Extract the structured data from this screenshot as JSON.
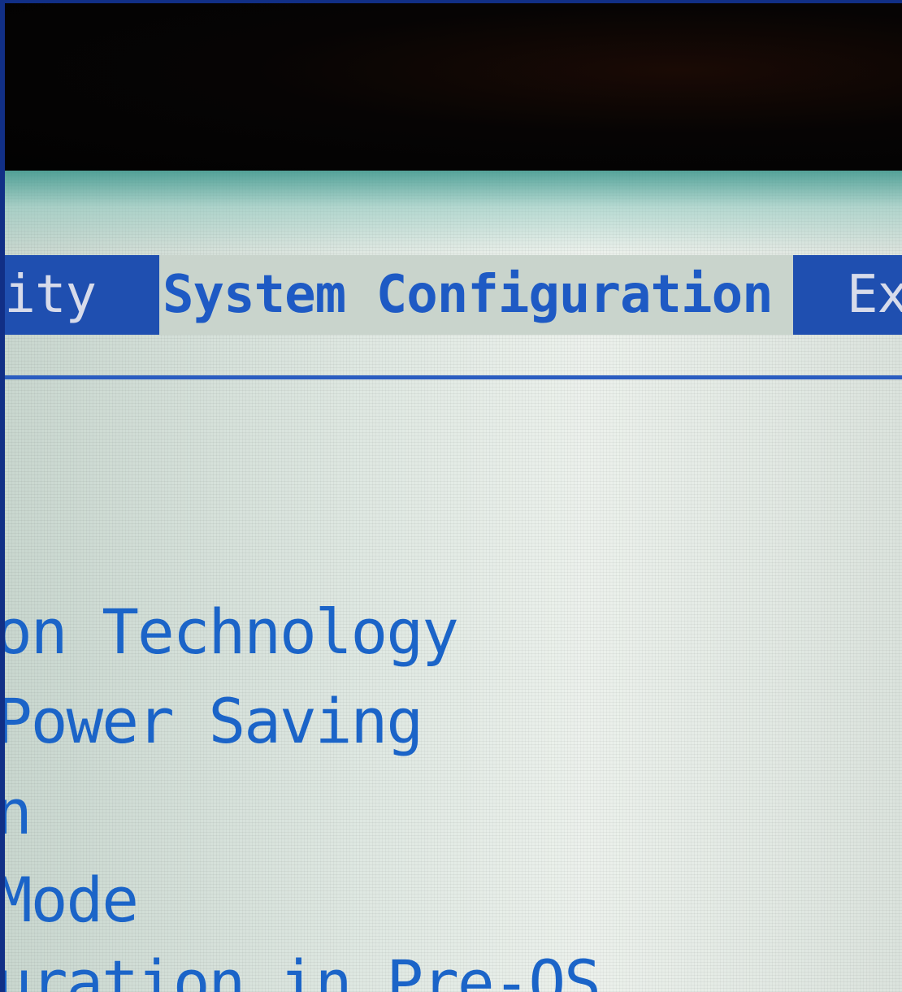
{
  "menu": {
    "tabs": [
      {
        "label": "ity",
        "active": false
      },
      {
        "label": "System Configuration",
        "active": true
      },
      {
        "label": "Ex",
        "active": false
      }
    ]
  },
  "options": [
    {
      "label": "on Technology"
    },
    {
      "label": "Power Saving"
    },
    {
      "label": "n"
    },
    {
      "label": "Mode"
    },
    {
      "label": "uration in Pre-OS"
    }
  ],
  "colors": {
    "menu_bar_inactive": "#1f4fb0",
    "text_blue": "#1b64c8",
    "panel_background": "#e3ebe5",
    "bezel": "#112f86"
  }
}
